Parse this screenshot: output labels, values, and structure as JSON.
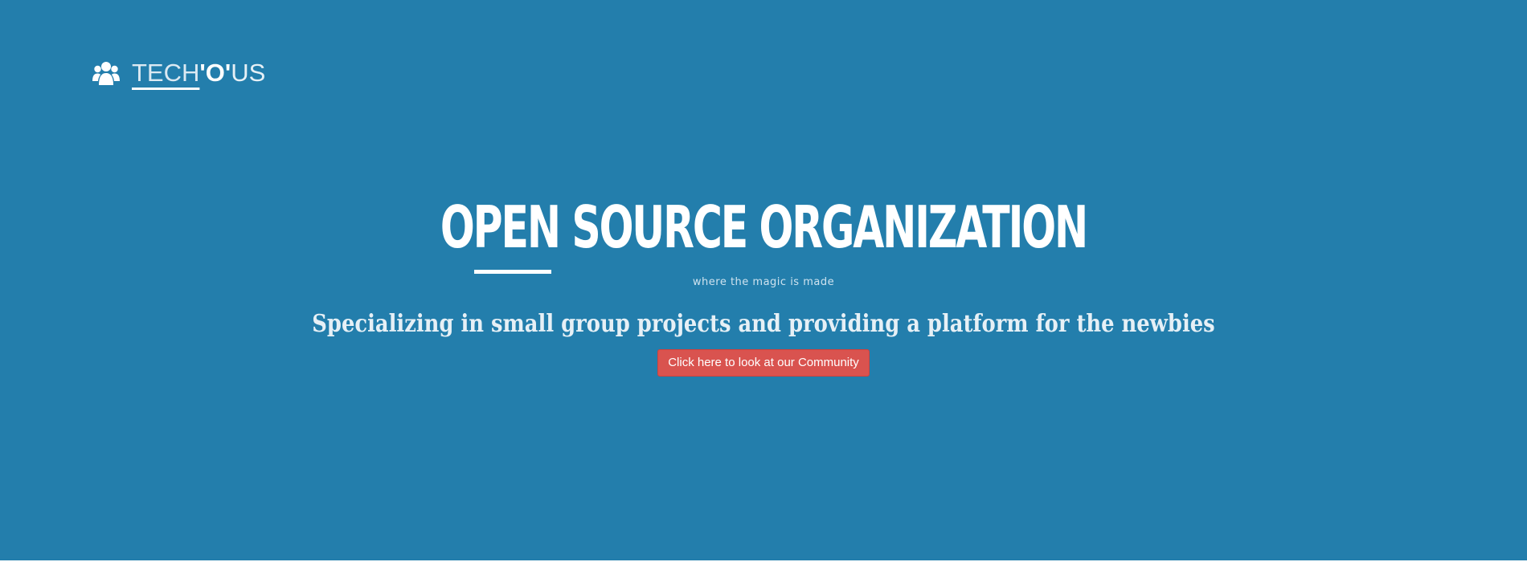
{
  "brand": {
    "icon": "users-icon",
    "part1": "TECH",
    "part2": "'O'",
    "part3": "US"
  },
  "hero": {
    "title": "OPEN SOURCE ORGANIZATION",
    "tagline": "where the magic is made",
    "subheading": "Specializing in small group projects and providing a platform for the newbies",
    "cta_label": "Click here to look at our Community"
  },
  "colors": {
    "background": "#237eac",
    "cta": "#d9534f",
    "text": "#ffffff"
  }
}
